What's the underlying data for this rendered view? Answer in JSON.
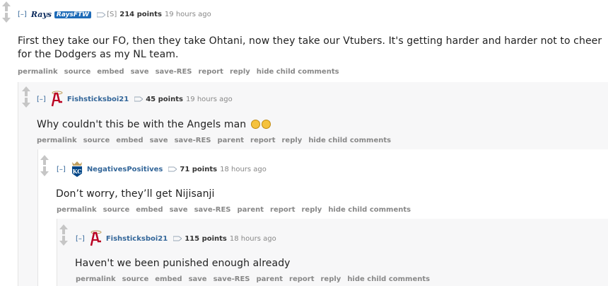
{
  "comments": [
    {
      "expand": "[–]",
      "author": "RaysFTW",
      "flair_label": "Rays",
      "res_label": "[S]",
      "score": "214 points",
      "time": "19 hours ago",
      "body": "First they take our FO, then they take Ohtani, now they take our Vtubers. It's getting harder and harder not to cheer for the Dodgers as my NL team.",
      "buttons": [
        "permalink",
        "source",
        "embed",
        "save",
        "save-RES",
        "report",
        "reply",
        "hide child comments"
      ]
    },
    {
      "expand": "[–]",
      "author": "Fishsticksboi21",
      "score": "45 points",
      "time": "19 hours ago",
      "body": "Why couldn't this be with the Angels man",
      "emoji_icons": [
        "pensive-face-icon",
        "pensive-face-icon"
      ],
      "buttons": [
        "permalink",
        "source",
        "embed",
        "save",
        "save-RES",
        "parent",
        "report",
        "reply",
        "hide child comments"
      ]
    },
    {
      "expand": "[–]",
      "author": "NegativesPositives",
      "score": "71 points",
      "time": "18 hours ago",
      "body": "Don’t worry, they’ll get Nijisanji",
      "buttons": [
        "permalink",
        "source",
        "embed",
        "save",
        "save-RES",
        "parent",
        "report",
        "reply",
        "hide child comments"
      ]
    },
    {
      "expand": "[–]",
      "author": "Fishsticksboi21",
      "score": "115 points",
      "time": "18 hours ago",
      "body": "Haven't we been punished enough already",
      "buttons": [
        "permalink",
        "source",
        "embed",
        "save",
        "save-RES",
        "parent",
        "report",
        "reply",
        "hide child comments"
      ]
    }
  ],
  "colors": {
    "link": "#336699",
    "meta": "#888888",
    "nested_bg": "#f7f7f8"
  }
}
